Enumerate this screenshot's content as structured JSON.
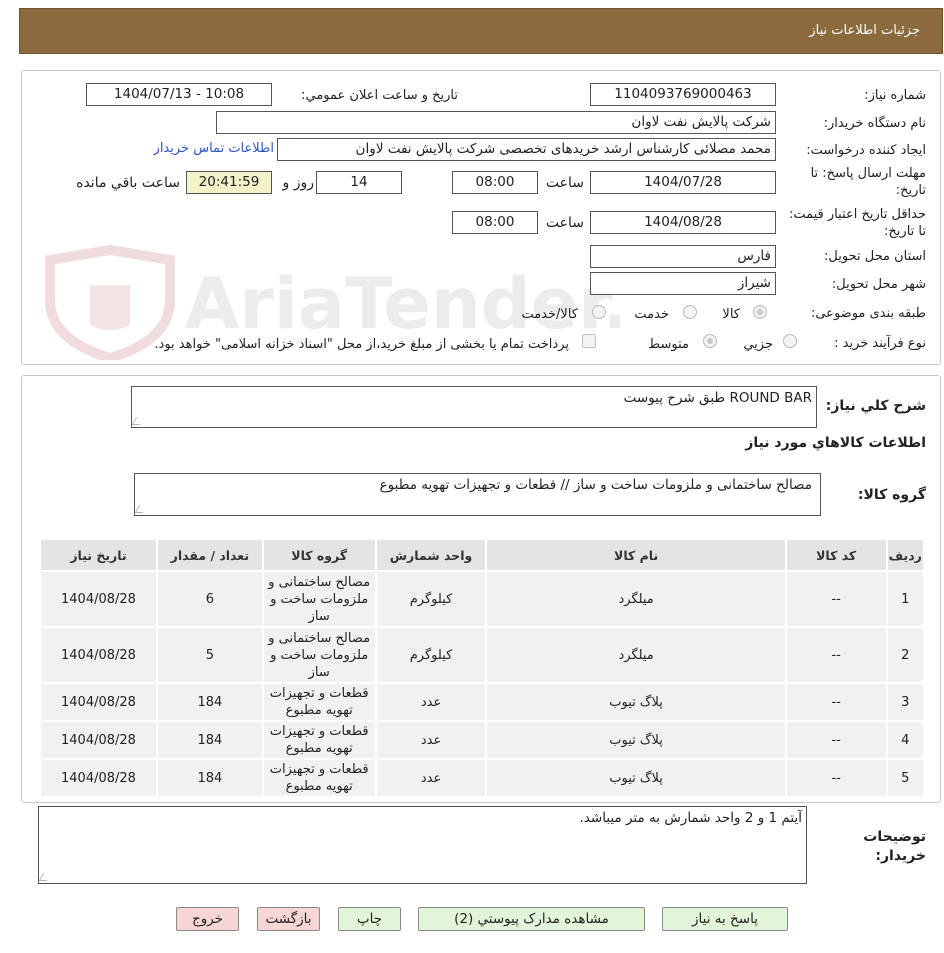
{
  "header": {
    "title": "جزئیات اطلاعات نیاز"
  },
  "watermark": {
    "text": "AriaTender.neT"
  },
  "form": {
    "need_number_label": "شماره نیاز:",
    "need_number": "1104093769000463",
    "announce_label": "تاریخ و ساعت اعلان عمومي:",
    "announce_value": "1404/07/13 - 10:08",
    "buyer_org_label": "نام دستگاه خریدار:",
    "buyer_org": "شرکت پالایش نفت لاوان",
    "requester_label": "ایجاد کننده درخواست:",
    "requester": "محمد مصلائی کارشناس ارشد خریدهای تخصصی شرکت پالایش نفت لاوان",
    "contact_link": "اطلاعات تماس خریدار",
    "reply_deadline_label": "مهلت ارسال پاسخ: تا تاریخ:",
    "reply_date": "1404/07/28",
    "time_label": "ساعت",
    "reply_time": "08:00",
    "days_value": "14",
    "days_label": "روز و",
    "timer_value": "20:41:59",
    "remaining_label": "ساعت باقي مانده",
    "price_validity_label": "حداقل تاریخ اعتبار قیمت: تا تاریخ:",
    "price_date": "1404/08/28",
    "price_time": "08:00",
    "province_label": "استان محل تحویل:",
    "province": "فارس",
    "city_label": "شهر محل تحویل:",
    "city": "شیراز",
    "category_label": "طبقه بندی موضوعی:",
    "category_options": [
      "کالا",
      "خدمت",
      "کالا/خدمت"
    ],
    "category_selected": "کالا",
    "process_label": "نوع فرآیند خرید :",
    "process_options": [
      "جزیي",
      "متوسط"
    ],
    "process_selected": "متوسط",
    "payment_note": "پرداخت تمام یا بخشی از مبلغ خرید،از محل \"اسناد خزانه اسلامی\" خواهد بود."
  },
  "details": {
    "general_desc_label": "شرح کلي نیاز:",
    "general_desc": "ROUND BAR طبق شرح پیوست",
    "goods_info_heading": "اطلاعات کالاهاي مورد نیاز",
    "goods_group_label": "گروه کالا:",
    "goods_group": "مصالح ساختمانی و ملزومات ساخت و ساز //  قطعات و تجهیزات تهویه مطبوع"
  },
  "table": {
    "headers": [
      "ردیف",
      "کد کالا",
      "نام کالا",
      "واحد شمارش",
      "گروه کالا",
      "تعداد / مقدار",
      "تاریخ نیاز"
    ],
    "rows": [
      [
        "1",
        "--",
        "میلگرد",
        "کیلوگرم",
        "مصالح ساختمانی و ملزومات ساخت و ساز",
        "6",
        "1404/08/28"
      ],
      [
        "2",
        "--",
        "میلگرد",
        "کیلوگرم",
        "مصالح ساختمانی و ملزومات ساخت و ساز",
        "5",
        "1404/08/28"
      ],
      [
        "3",
        "--",
        "پلاگ تیوب",
        "عدد",
        "قطعات و تجهیزات تهویه مطبوع",
        "184",
        "1404/08/28"
      ],
      [
        "4",
        "--",
        "پلاگ تیوب",
        "عدد",
        "قطعات و تجهیزات تهویه مطبوع",
        "184",
        "1404/08/28"
      ],
      [
        "5",
        "--",
        "پلاگ تیوب",
        "عدد",
        "قطعات و تجهیزات تهویه مطبوع",
        "184",
        "1404/08/28"
      ]
    ]
  },
  "buyer_notes": {
    "label": "توضیحات خریدار:",
    "text": "آیتم 1 و 2 واحد شمارش به متر میباشد."
  },
  "buttons": {
    "reply": "پاسخ به نیاز",
    "attachments": "مشاهده مدارک پیوستي (2)",
    "print": "چاپ",
    "back": "بازگشت",
    "exit": "خروج"
  }
}
